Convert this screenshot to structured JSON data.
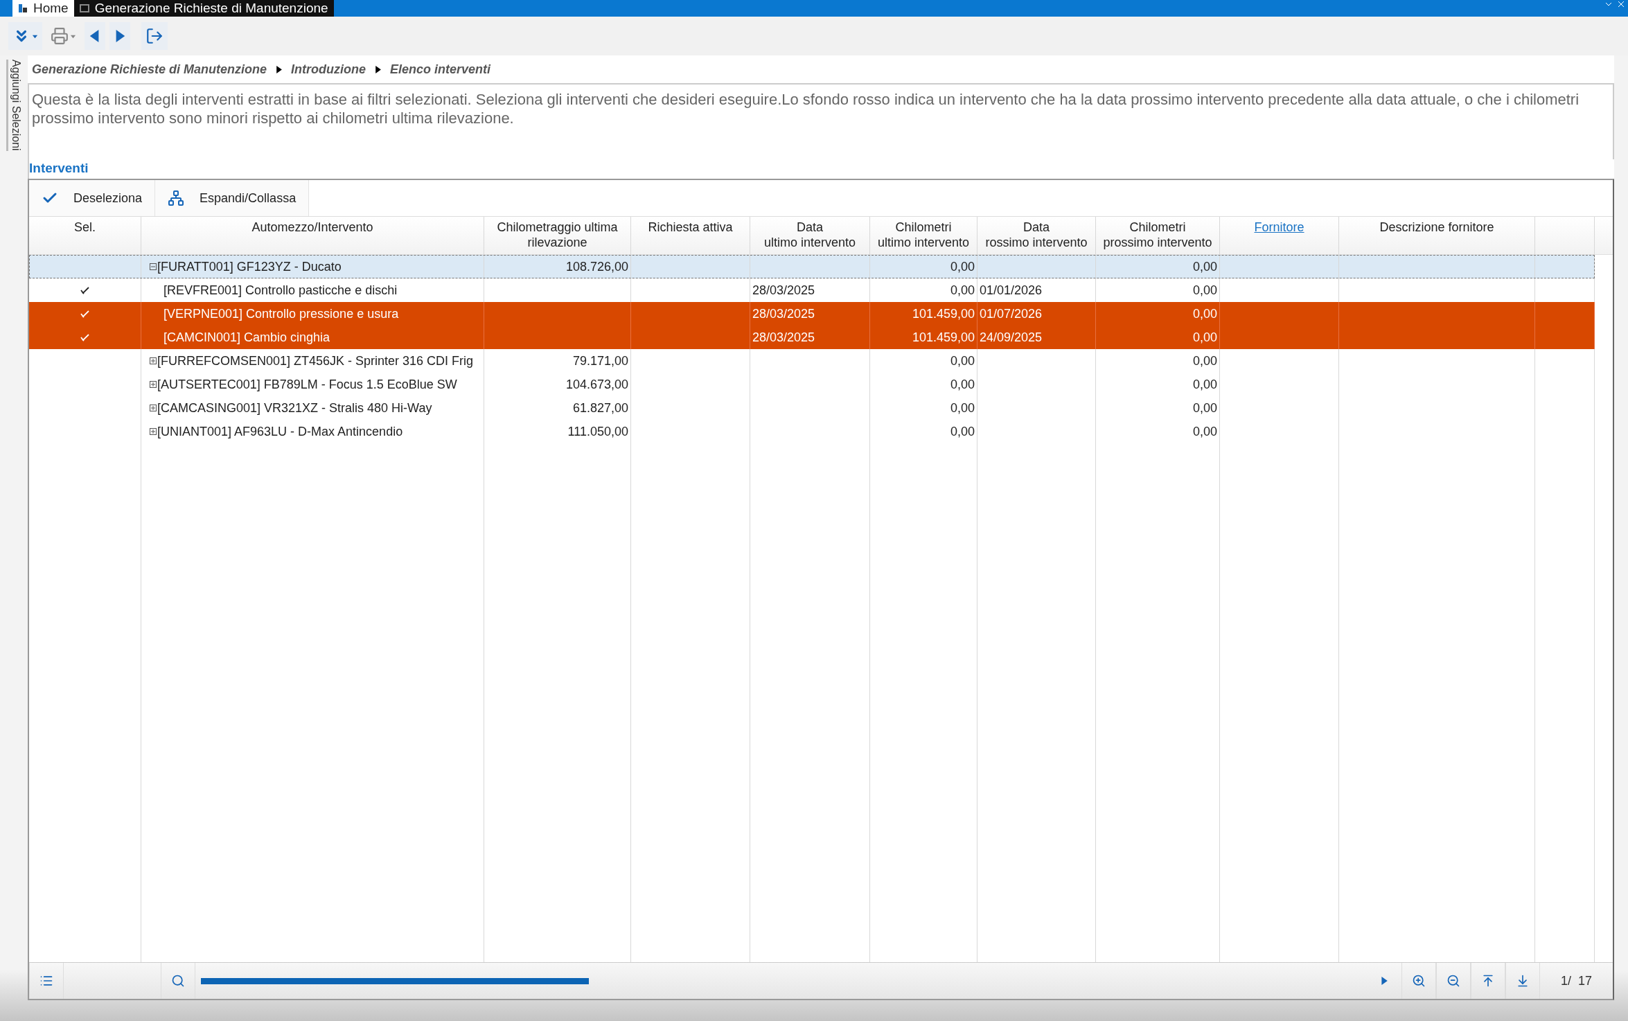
{
  "tabs": [
    {
      "label": "Home",
      "selected": false
    },
    {
      "label": "Generazione Richieste di Manutenzione",
      "selected": true
    }
  ],
  "sidebar": {
    "label": "Aggiungi Selezioni"
  },
  "breadcrumb": [
    "Generazione Richieste di Manutenzione",
    "Introduzione",
    "Elenco interventi"
  ],
  "description": "Questa è la lista degli interventi estratti in base ai filtri selezionati. Seleziona gli interventi che desideri eseguire.Lo sfondo rosso indica un intervento che ha la data prossimo intervento precedente alla data attuale, o che i chilometri prossimo intervento sono minori rispetto ai chilometri ultima rilevazione.",
  "section_title": "Interventi",
  "grid_toolbar": [
    {
      "label": "Deseleziona",
      "kind": "deselect"
    },
    {
      "label": "Espandi/Collassa",
      "kind": "tree"
    }
  ],
  "columns": [
    {
      "lines": [
        "Sel."
      ],
      "kind": "text"
    },
    {
      "lines": [
        "Automezzo/Intervento"
      ],
      "kind": "text"
    },
    {
      "lines": [
        "Chilometraggio ultima",
        "rilevazione"
      ],
      "kind": "text"
    },
    {
      "lines": [
        "Richiesta attiva"
      ],
      "kind": "text"
    },
    {
      "lines": [
        "Data",
        "ultimo intervento"
      ],
      "kind": "text"
    },
    {
      "lines": [
        "Chilometri",
        "ultimo intervento"
      ],
      "kind": "text"
    },
    {
      "lines": [
        "Data",
        "rossimo intervento"
      ],
      "kind": "text"
    },
    {
      "lines": [
        "Chilometri",
        "prossimo intervento"
      ],
      "kind": "text"
    },
    {
      "lines": [
        "Fornitore"
      ],
      "kind": "link"
    },
    {
      "lines": [
        "Descrizione fornitore"
      ],
      "kind": "text"
    }
  ],
  "rows": [
    {
      "text": "[FURATT001] GF123YZ - Ducato",
      "expanded": true,
      "selected": true,
      "km_reading": "108.726,00",
      "km_last": "0,00",
      "km_next": "0,00",
      "children": [
        {
          "text": "[REVFRE001] Controllo pasticche e dischi",
          "selected": false,
          "checked": true,
          "overdue": false,
          "date_last": "28/03/2025",
          "km_last": "0,00",
          "date_next": "01/01/2026",
          "km_next": "0,00"
        },
        {
          "text": "[VERPNE001] Controllo pressione e usura",
          "selected": false,
          "checked": true,
          "overdue": true,
          "date_last": "28/03/2025",
          "km_last": "101.459,00",
          "date_next": "01/07/2026",
          "km_next": "0,00"
        },
        {
          "text": "[CAMCIN001] Cambio cinghia",
          "selected": false,
          "checked": true,
          "overdue": true,
          "date_last": "28/03/2025",
          "km_last": "101.459,00",
          "date_next": "24/09/2025",
          "km_next": "0,00"
        }
      ]
    },
    {
      "text": "[FURREFCOMSEN001] ZT456JK - Sprinter 316 CDI Frig",
      "expanded": false,
      "selected": false,
      "km_reading": "79.171,00",
      "km_last": "0,00",
      "km_next": "0,00"
    },
    {
      "text": "[AUTSERTEC001] FB789LM - Focus 1.5 EcoBlue SW",
      "expanded": false,
      "selected": false,
      "km_reading": "104.673,00",
      "km_last": "0,00",
      "km_next": "0,00"
    },
    {
      "text": "[CAMCASING001] VR321XZ - Stralis 480 Hi-Way",
      "expanded": false,
      "selected": false,
      "km_reading": "61.827,00",
      "km_last": "0,00",
      "km_next": "0,00"
    },
    {
      "text": "[UNIANT001] AF963LU - D-Max Antincendio",
      "expanded": false,
      "selected": false,
      "km_reading": "111.050,00",
      "km_last": "0,00",
      "km_next": "0,00"
    }
  ],
  "pager": "1/  17"
}
